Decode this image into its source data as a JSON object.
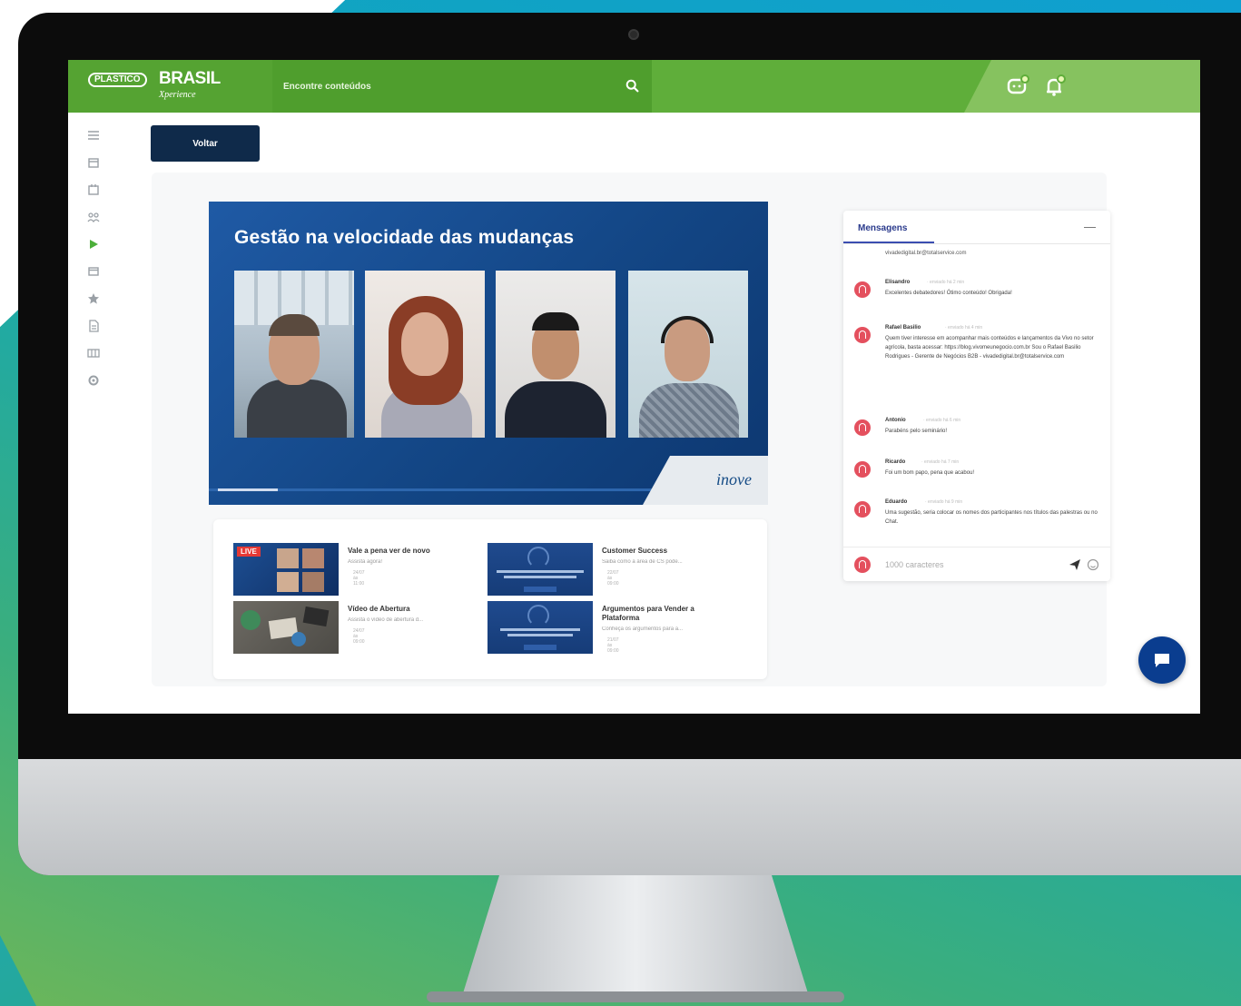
{
  "header": {
    "logo_badge": "PLASTICO",
    "logo_name": "BRASIL",
    "logo_sub": "Xperience",
    "search_placeholder": "Encontre conteúdos"
  },
  "toolbar": {
    "back_label": "Voltar"
  },
  "video": {
    "title": "Gestão na velocidade das mudanças",
    "brand": "inove",
    "progress": 0.11
  },
  "playlist": {
    "items": [
      {
        "title": "Vale a pena ver de novo",
        "desc": "Assista agora!",
        "date": "24/07 às 11:00",
        "badge": "LIVE"
      },
      {
        "title": "Customer Success",
        "desc": "Saiba como a área de CS pode...",
        "date": "22/07 às 09:00"
      },
      {
        "title": "Vídeo de Abertura",
        "desc": "Assista o vídeo de abertura d...",
        "date": "24/07 às 09:00"
      },
      {
        "title": "Argumentos para Vender a Plataforma",
        "desc": "Conheça os argumentos para a...",
        "date": "21/07 às 09:00"
      }
    ]
  },
  "chat": {
    "tab": "Mensagens",
    "menu": "—",
    "continued": "vivadedigital.br@totalservice.com",
    "messages": [
      {
        "name": "Elisandro",
        "time": "· enviado há 2 min",
        "text": "Excelentes debatedores! Ótimo conteúdo! Obrigada!"
      },
      {
        "name": "Rafael Basilio",
        "time": "· enviado há 4 min",
        "text": "Quem tiver interesse em acompanhar mais conteúdos e lançamentos da Vivo no setor agrícola, basta acessar: https://blog.vivomeunegocio.com.br Sou o Rafael Basilio Rodrigues - Gerente de Negócios B2B - vivadedigital.br@totalservice.com"
      },
      {
        "name": "Antonio",
        "time": "· enviado há 6 min",
        "text": "Parabéns pelo seminário!"
      },
      {
        "name": "Ricardo",
        "time": "· enviado há 7 min",
        "text": "Foi um bom papo, pena que acabou!"
      },
      {
        "name": "Eduardo",
        "time": "· enviado há 9 min",
        "text": "Uma sugestão, seria colocar os nomes dos participantes nos títulos das palestras ou no Chat."
      }
    ],
    "input_placeholder": "1000 caracteres"
  },
  "colors": {
    "topbar": "#5fae3a",
    "navy": "#0f2a4a",
    "chat_accent": "#3b4db0",
    "avatar": "#e4505e"
  }
}
